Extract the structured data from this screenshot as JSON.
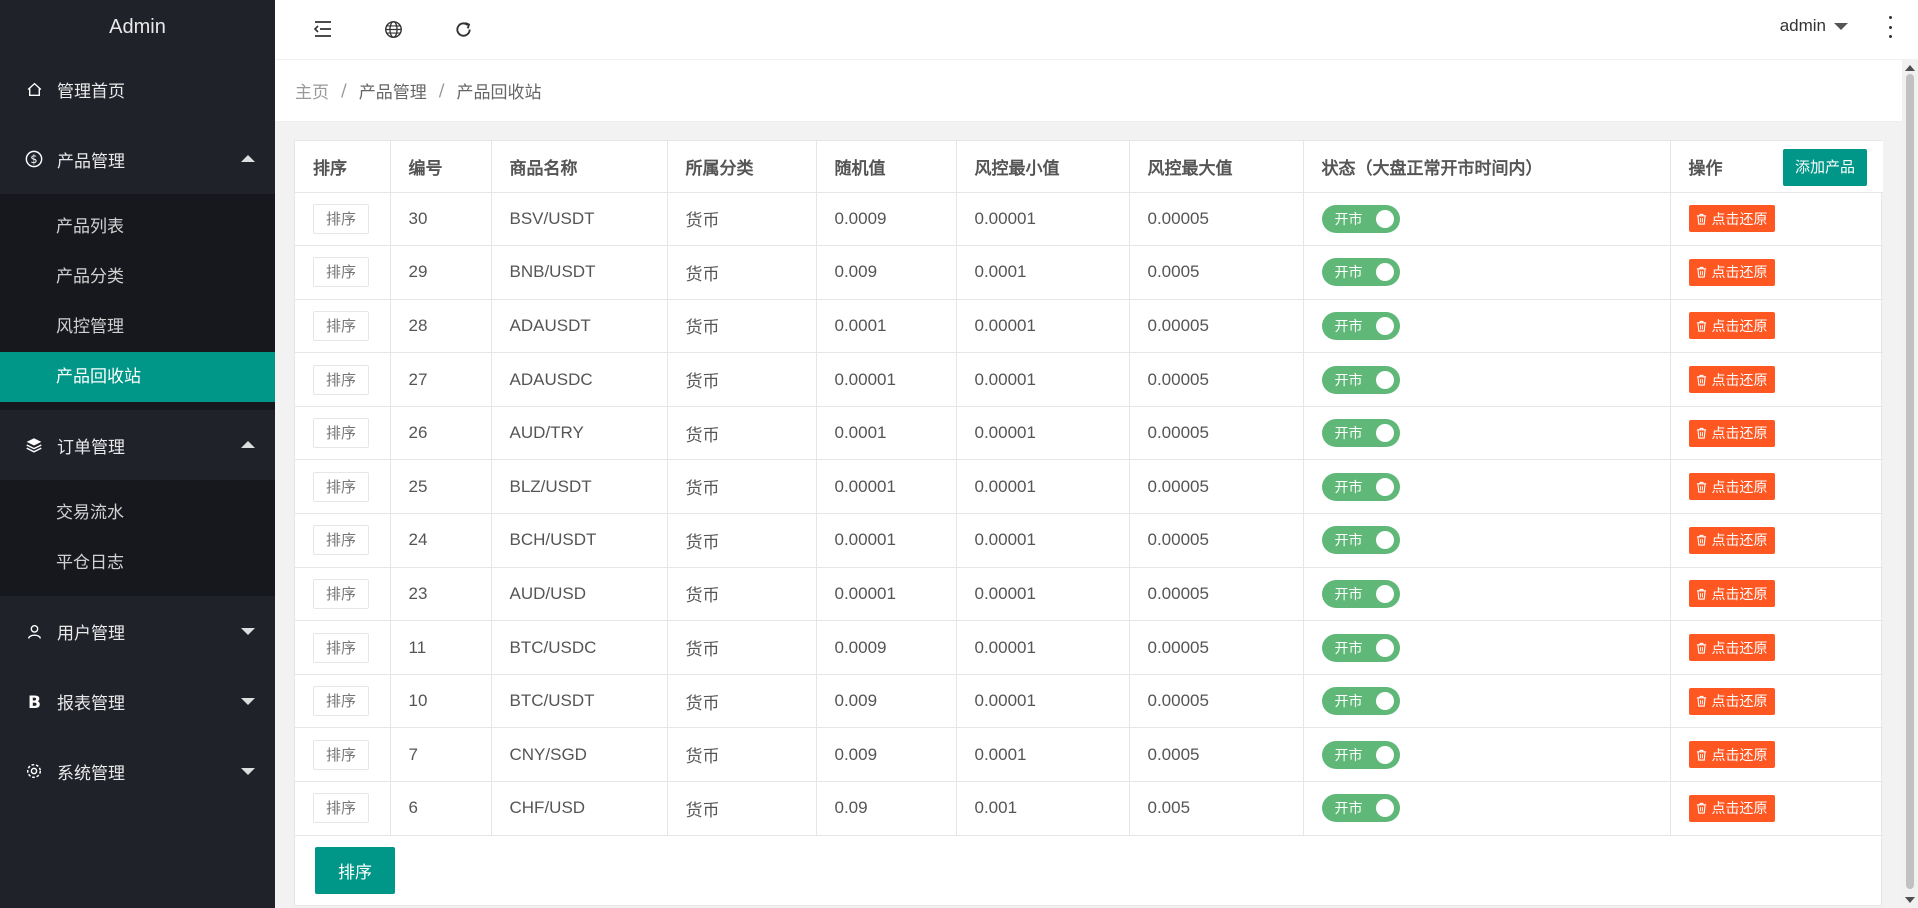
{
  "app": {
    "brand": "Admin"
  },
  "header": {
    "user": "admin"
  },
  "sidebar": {
    "items": [
      {
        "label": "管理首页"
      },
      {
        "label": "产品管理",
        "children": [
          "产品列表",
          "产品分类",
          "风控管理",
          "产品回收站"
        ]
      },
      {
        "label": "订单管理",
        "children": [
          "交易流水",
          "平仓日志"
        ]
      },
      {
        "label": "用户管理"
      },
      {
        "label": "报表管理"
      },
      {
        "label": "系统管理"
      }
    ]
  },
  "breadcrumb": [
    "主页",
    "产品管理",
    "产品回收站"
  ],
  "table": {
    "columns": [
      "排序",
      "编号",
      "商品名称",
      "所属分类",
      "随机值",
      "风控最小值",
      "风控最大值",
      "状态（大盘正常开市时间内）",
      "操作"
    ],
    "add_button": "添加产品",
    "sort_placeholder": "排序",
    "switch_label": "开市",
    "restore_label": "点击还原",
    "rows": [
      {
        "id": "30",
        "name": "BSV/USDT",
        "category": "货币",
        "random": "0.0009",
        "min": "0.00001",
        "max": "0.00005"
      },
      {
        "id": "29",
        "name": "BNB/USDT",
        "category": "货币",
        "random": "0.009",
        "min": "0.0001",
        "max": "0.0005"
      },
      {
        "id": "28",
        "name": "ADAUSDT",
        "category": "货币",
        "random": "0.0001",
        "min": "0.00001",
        "max": "0.00005"
      },
      {
        "id": "27",
        "name": "ADAUSDC",
        "category": "货币",
        "random": "0.00001",
        "min": "0.00001",
        "max": "0.00005"
      },
      {
        "id": "26",
        "name": "AUD/TRY",
        "category": "货币",
        "random": "0.0001",
        "min": "0.00001",
        "max": "0.00005"
      },
      {
        "id": "25",
        "name": "BLZ/USDT",
        "category": "货币",
        "random": "0.00001",
        "min": "0.00001",
        "max": "0.00005"
      },
      {
        "id": "24",
        "name": "BCH/USDT",
        "category": "货币",
        "random": "0.00001",
        "min": "0.00001",
        "max": "0.00005"
      },
      {
        "id": "23",
        "name": "AUD/USD",
        "category": "货币",
        "random": "0.00001",
        "min": "0.00001",
        "max": "0.00005"
      },
      {
        "id": "11",
        "name": "BTC/USDC",
        "category": "货币",
        "random": "0.0009",
        "min": "0.00001",
        "max": "0.00005"
      },
      {
        "id": "10",
        "name": "BTC/USDT",
        "category": "货币",
        "random": "0.009",
        "min": "0.00001",
        "max": "0.00005"
      },
      {
        "id": "7",
        "name": "CNY/SGD",
        "category": "货币",
        "random": "0.009",
        "min": "0.0001",
        "max": "0.0005"
      },
      {
        "id": "6",
        "name": "CHF/USD",
        "category": "货币",
        "random": "0.09",
        "min": "0.001",
        "max": "0.005"
      }
    ],
    "bottom_sort_button": "排序"
  },
  "colors": {
    "sidebar_bg": "#20222a",
    "accent": "#009688",
    "switch_on": "#5fb878",
    "danger": "#ff5722"
  }
}
